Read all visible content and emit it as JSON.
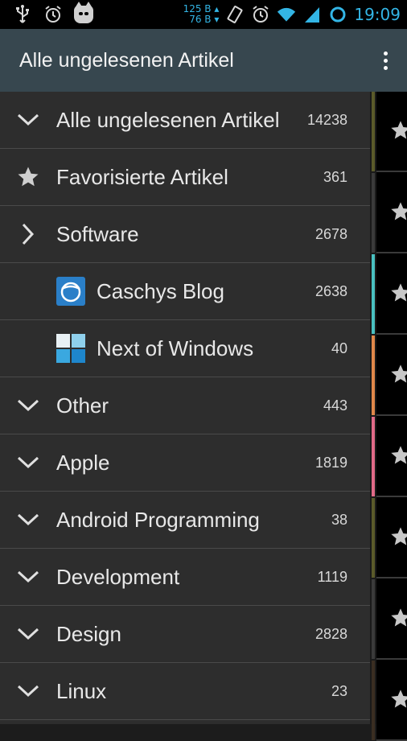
{
  "status_bar": {
    "net_up": "125 B ▴",
    "net_down": "76 B ▾",
    "time": "19:09"
  },
  "action_bar": {
    "title": "Alle ungelesenen Artikel"
  },
  "drawer": {
    "items": [
      {
        "icon": "chevron-down-icon",
        "label": "Alle ungelesenen Artikel",
        "count": "14238"
      },
      {
        "icon": "star-icon",
        "label": "Favorisierte Artikel",
        "count": "361"
      },
      {
        "icon": "chevron-right-icon",
        "label": "Software",
        "count": "2678"
      },
      {
        "icon": "caschys-blog-icon",
        "label": "Caschys Blog",
        "count": "2638"
      },
      {
        "icon": "next-of-windows-icon",
        "label": "Next of Windows",
        "count": "40"
      },
      {
        "icon": "chevron-down-icon",
        "label": "Other",
        "count": "443"
      },
      {
        "icon": "chevron-down-icon",
        "label": "Apple",
        "count": "1819"
      },
      {
        "icon": "chevron-down-icon",
        "label": "Android Programming",
        "count": "38"
      },
      {
        "icon": "chevron-down-icon",
        "label": "Development",
        "count": "1119"
      },
      {
        "icon": "chevron-down-icon",
        "label": "Design",
        "count": "2828"
      },
      {
        "icon": "chevron-down-icon",
        "label": "Linux",
        "count": "23"
      }
    ]
  },
  "article_list": {
    "accent_colors": [
      "#5a5a2a",
      "#3a3a3a",
      "#49c0c0",
      "#e0884a",
      "#e06a88",
      "#5a5a2a",
      "#3a3a3a",
      "#3a2e22"
    ],
    "star_color": "#c8c8c8"
  },
  "colors": {
    "accent": "#33b5e5",
    "action_bar": "#37474f"
  }
}
